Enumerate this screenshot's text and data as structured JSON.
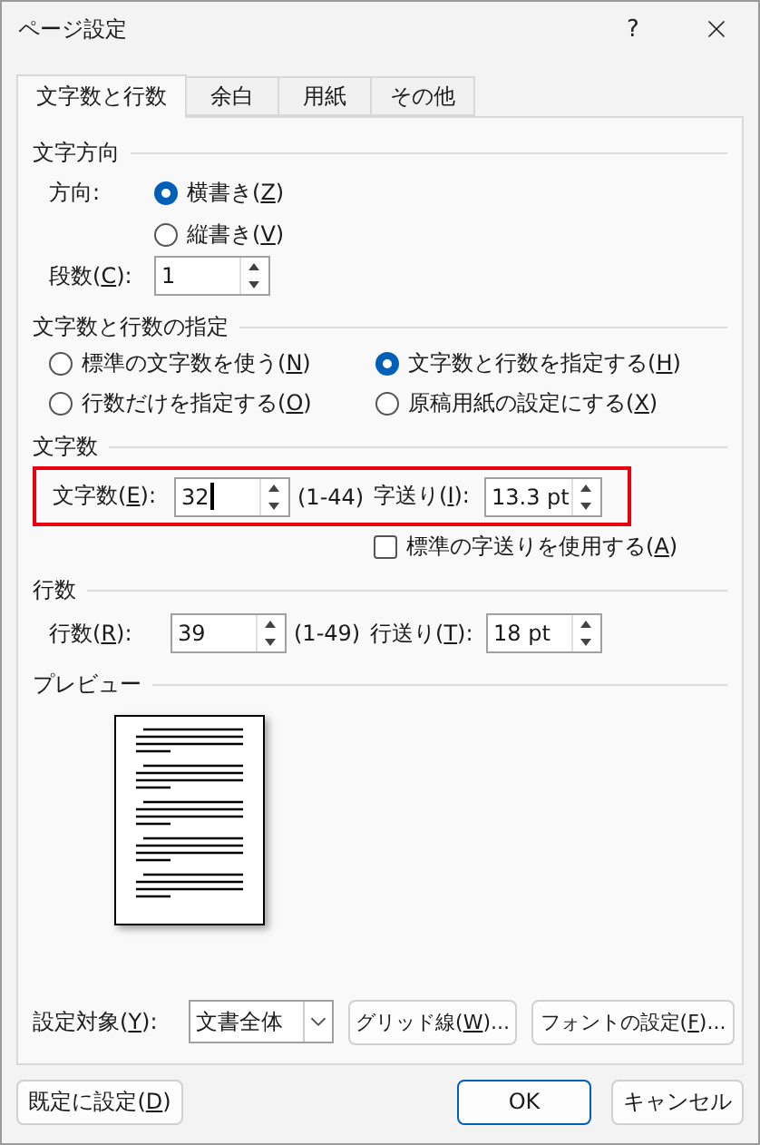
{
  "window": {
    "title": "ページ設定",
    "help": "?"
  },
  "tabs": [
    {
      "label": "文字数と行数",
      "selected": true
    },
    {
      "label": "余白",
      "selected": false
    },
    {
      "label": "用紙",
      "selected": false
    },
    {
      "label": "その他",
      "selected": false
    }
  ],
  "text_direction": {
    "heading": "文字方向",
    "direction_label": "方向:",
    "options": [
      {
        "label": "横書き(Z)",
        "selected": true
      },
      {
        "label": "縦書き(V)",
        "selected": false
      }
    ],
    "columns_label": "段数(C):",
    "columns_value": "1"
  },
  "grid_mode": {
    "heading": "文字数と行数の指定",
    "options": [
      {
        "label": "標準の文字数を使う(N)",
        "selected": false
      },
      {
        "label": "文字数と行数を指定する(H)",
        "selected": true
      },
      {
        "label": "行数だけを指定する(O)",
        "selected": false
      },
      {
        "label": "原稿用紙の設定にする(X)",
        "selected": false
      }
    ]
  },
  "chars": {
    "heading": "文字数",
    "highlighted": true,
    "count_label": "文字数(E):",
    "count_value": "32",
    "focused": true,
    "count_range": "(1-44)",
    "pitch_label": "字送り(I):",
    "pitch_value": "13.3 pt",
    "default_pitch": {
      "label": "標準の字送りを使用する(A)",
      "checked": false
    }
  },
  "lines": {
    "heading": "行数",
    "count_label": "行数(R):",
    "count_value": "39",
    "count_range": "(1-49)",
    "pitch_label": "行送り(T):",
    "pitch_value": "18 pt"
  },
  "preview": {
    "heading": "プレビュー"
  },
  "apply_to": {
    "label": "設定対象(Y):",
    "value": "文書全体"
  },
  "panel_buttons": [
    "グリッド線(W)...",
    "フォントの設定(F)..."
  ],
  "footer": {
    "default_button": "既定に設定(D)",
    "ok": "OK",
    "cancel": "キャンセル"
  }
}
